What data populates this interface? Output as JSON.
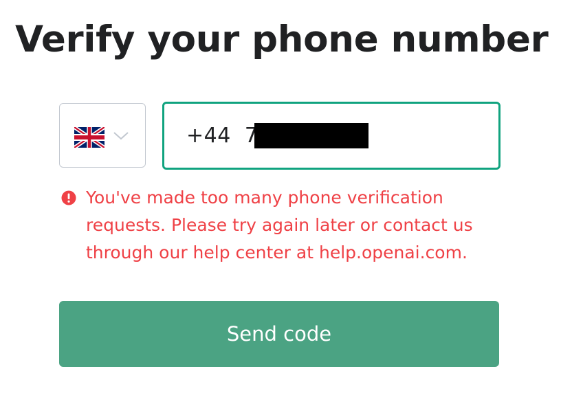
{
  "page": {
    "title": "Verify your phone number"
  },
  "country_select": {
    "flag_icon": "uk-flag-icon",
    "chevron_icon": "chevron-down-icon",
    "border_color": "#c2c8d0"
  },
  "phone_input": {
    "value": "+44  7",
    "redacted": true,
    "focus_border_color": "#10a37f"
  },
  "error": {
    "icon": "exclamation-circle-icon",
    "lines": [
      "You've made too many phone verification",
      "requests. Please try again later or contact us",
      "through our help center at help.openai.com."
    ],
    "color": "#ef4146"
  },
  "send_button": {
    "label": "Send code",
    "background": "#4ba383"
  }
}
